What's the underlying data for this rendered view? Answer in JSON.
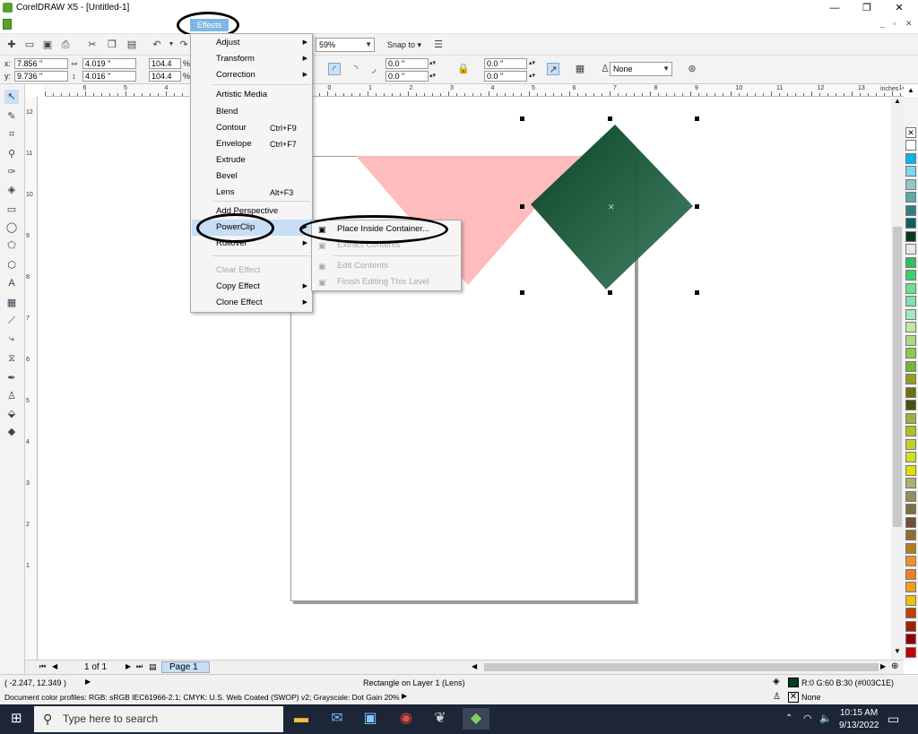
{
  "title": "CorelDRAW X5 - [Untitled-1]",
  "menu": {
    "effects": "Effects"
  },
  "toolbar": {
    "zoom": "59%",
    "snap": "Snap to",
    "outline_none": "None"
  },
  "propbar": {
    "x": "7.856 \"",
    "y": "9.736 \"",
    "w": "4.019 \"",
    "h": "4.016 \"",
    "sx": "104.4",
    "sy": "104.4",
    "c1": "0.0 \"",
    "c2": "0.0 \"",
    "c3": "0.0 \"",
    "c4": "0.0 \""
  },
  "ruler": {
    "units": "inches",
    "top_ticks": [
      "4",
      "6",
      "5",
      "4",
      "3",
      "2",
      "1",
      "0",
      "1",
      "2",
      "3",
      "4",
      "5",
      "6",
      "7",
      "8",
      "9",
      "10",
      "11",
      "12",
      "13",
      "14"
    ],
    "left_ticks": [
      "12",
      "11",
      "10",
      "9",
      "8",
      "7",
      "6",
      "5",
      "4",
      "3",
      "2",
      "1"
    ]
  },
  "effects_menu": [
    {
      "label": "Adjust",
      "sub": true
    },
    {
      "label": "Transform",
      "sub": true
    },
    {
      "label": "Correction",
      "sub": true
    },
    {
      "label": "Artistic Media"
    },
    {
      "label": "Blend"
    },
    {
      "label": "Contour",
      "shortcut": "Ctrl+F9"
    },
    {
      "label": "Envelope",
      "shortcut": "Ctrl+F7"
    },
    {
      "label": "Extrude"
    },
    {
      "label": "Bevel"
    },
    {
      "label": "Lens",
      "shortcut": "Alt+F3"
    },
    {
      "label": "Add Perspective"
    },
    {
      "label": "PowerClip",
      "sub": true
    },
    {
      "label": "Rollover",
      "sub": true
    },
    {
      "label": "Clear Effect"
    },
    {
      "label": "Copy Effect",
      "sub": true
    },
    {
      "label": "Clone Effect",
      "sub": true
    }
  ],
  "powerclip_menu": [
    {
      "label": "Place Inside Container..."
    },
    {
      "label": "Extract Contents"
    },
    {
      "label": "Edit Contents"
    },
    {
      "label": "Finish Editing This Level"
    }
  ],
  "pagebar": {
    "count": "1 of 1",
    "tab": "Page 1"
  },
  "status": {
    "coords": "( -2.247, 12.349 )",
    "object": "Rectangle on Layer 1  (Lens)",
    "fill": "R:0 G:60 B:30 (#003C1E)",
    "outline": "None",
    "profiles": "Document color profiles: RGB: sRGB IEC61966-2.1; CMYK: U.S. Web Coated (SWOP) v2; Grayscale: Dot Gain 20%"
  },
  "taskbar": {
    "search": "Type here to search",
    "time": "10:15 AM",
    "date": "9/13/2022"
  },
  "colors": {
    "diamond": "#003C1E",
    "triangle": "#ffb8b8",
    "highlight": "#c7def5"
  },
  "palette": [
    "#ffffff",
    "#00b4f0",
    "#7fd6f0",
    "#8fc9c9",
    "#5fa8a8",
    "#2f7f7f",
    "#0f5f5f",
    "#003c1e",
    "#e8e8e8",
    "#2dbf5f",
    "#3fcf6f",
    "#6fdf8f",
    "#7fe0b0",
    "#9fe8c0",
    "#bfe8a0",
    "#afd880",
    "#8fc850",
    "#6fb830",
    "#8f9f20",
    "#6f6f10",
    "#4f4f10",
    "#9faf40",
    "#afc020",
    "#c0d030",
    "#cfe020",
    "#dfdf00",
    "#afaf70",
    "#8f8f60",
    "#7f6f40",
    "#6f5030",
    "#8f6f30",
    "#af7f20",
    "#ef8f30",
    "#f07f20",
    "#f0a020",
    "#f0c000",
    "#c04000",
    "#a02000",
    "#900000",
    "#c00000"
  ]
}
